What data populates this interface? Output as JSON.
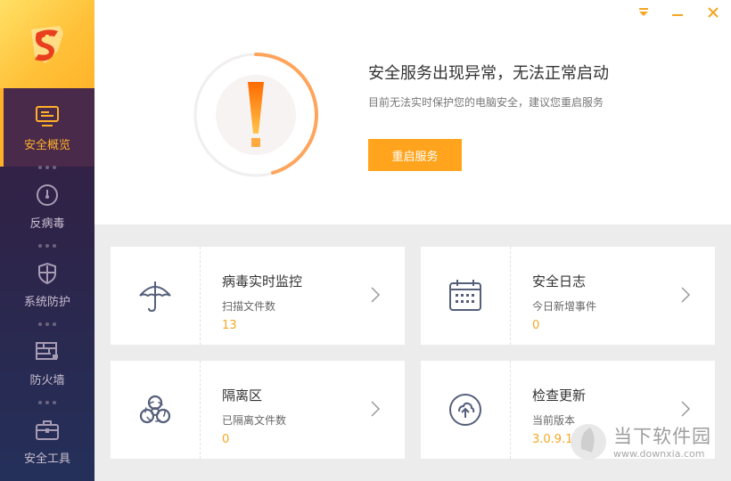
{
  "colors": {
    "accent": "#ffa41c",
    "sidebar": "#2f2348",
    "active_text": "#ffb02a"
  },
  "sidebar": {
    "items": [
      {
        "label": "安全概览",
        "icon": "monitor-icon",
        "active": true
      },
      {
        "label": "反病毒",
        "icon": "gauge-icon",
        "active": false
      },
      {
        "label": "系统防护",
        "icon": "shield-icon",
        "active": false
      },
      {
        "label": "防火墙",
        "icon": "firewall-icon",
        "active": false
      },
      {
        "label": "安全工具",
        "icon": "toolbox-icon",
        "active": false
      }
    ]
  },
  "window_controls": [
    "menu-icon",
    "minimize-icon",
    "close-icon"
  ],
  "alert": {
    "title": "安全服务出现异常，无法正常启动",
    "subtitle": "目前无法实时保护您的电脑安全，建议您重启服务",
    "button": "重启服务"
  },
  "cards": [
    {
      "title": "病毒实时监控",
      "label": "扫描文件数",
      "value": "13",
      "icon": "umbrella-icon"
    },
    {
      "title": "安全日志",
      "label": "今日新增事件",
      "value": "0",
      "icon": "calendar-icon"
    },
    {
      "title": "隔离区",
      "label": "已隔离文件数",
      "value": "0",
      "icon": "biohazard-icon"
    },
    {
      "title": "检查更新",
      "label": "当前版本",
      "value": "3.0.9.1",
      "icon": "upload-icon"
    }
  ],
  "watermark": {
    "text": "当下软件园",
    "url": "www.downxia.com"
  }
}
